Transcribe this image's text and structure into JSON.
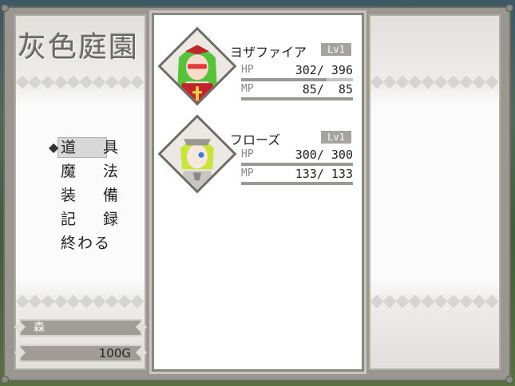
{
  "game_title": "灰色庭園",
  "menu": {
    "items": [
      "道 具",
      "魔 法",
      "装 備",
      "記 録",
      "終わる"
    ],
    "selected_index": 0,
    "cursor": "◆"
  },
  "location": "森",
  "gold": "100G",
  "party": [
    {
      "name": "ヨザファイア",
      "level": "Lv1",
      "hp_label": "HP",
      "hp": "302/ 396",
      "hp_ratio": 0.763,
      "mp_label": "MP",
      "mp": " 85/  85",
      "mp_ratio": 1.0,
      "hair_color": "#58c23a",
      "outfit_color": "#c0252b"
    },
    {
      "name": "フローズ",
      "level": "Lv1",
      "hp_label": "HP",
      "hp": "300/ 300",
      "hp_ratio": 1.0,
      "mp_label": "MP",
      "mp": "133/ 133",
      "mp_ratio": 1.0,
      "hair_color": "#c9e43a",
      "outfit_color": "#c8c6c2"
    }
  ]
}
